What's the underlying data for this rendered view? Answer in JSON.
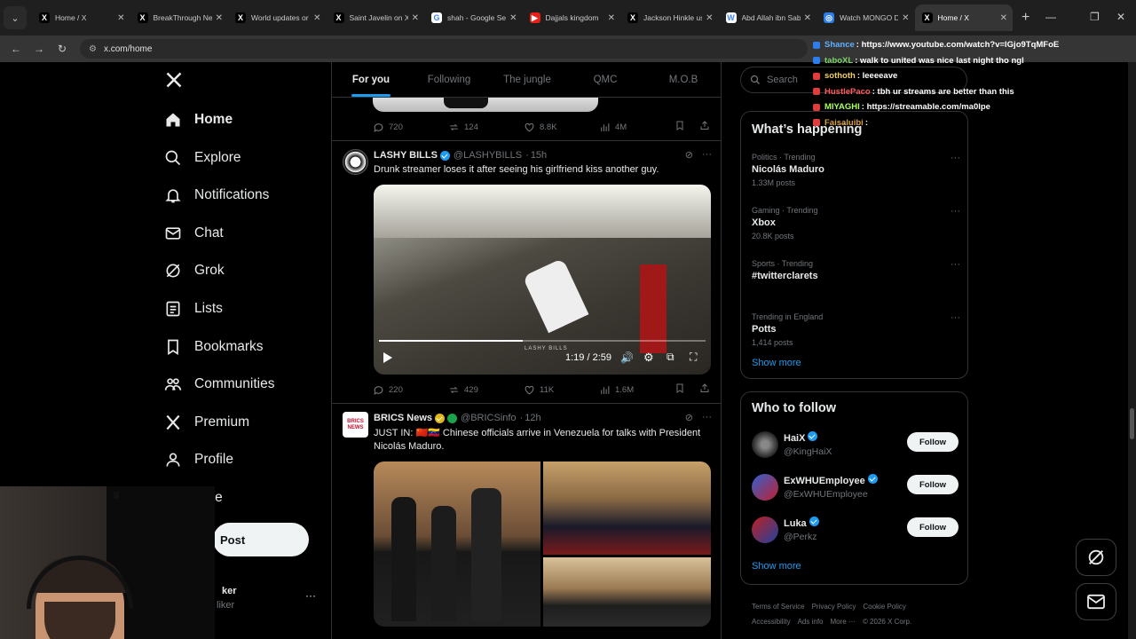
{
  "browser": {
    "tabs": [
      {
        "title": "Home / X",
        "icon": "x-logo-icon",
        "active": false
      },
      {
        "title": "BreakThrough Ne",
        "icon": "x-logo-icon",
        "active": false
      },
      {
        "title": "World updates or",
        "icon": "x-logo-icon",
        "active": false
      },
      {
        "title": "Saint Javelin on X",
        "icon": "x-logo-icon",
        "active": false
      },
      {
        "title": "shah - Google Sea",
        "icon": "google-icon",
        "active": false
      },
      {
        "title": "Dajjals kingdom",
        "icon": "youtube-icon",
        "active": false
      },
      {
        "title": "Jackson Hinkle us",
        "icon": "x-logo-icon",
        "active": false
      },
      {
        "title": "Abd Allah ibn Sab",
        "icon": "wikipedia-icon",
        "active": false
      },
      {
        "title": "Watch MONGO D",
        "icon": "globe-icon",
        "active": false
      },
      {
        "title": "Home / X",
        "icon": "x-logo-icon",
        "active": true
      }
    ],
    "url": "x.com/home"
  },
  "sidebar": {
    "items": [
      {
        "label": "Home",
        "icon": "home-icon"
      },
      {
        "label": "Explore",
        "icon": "search-icon"
      },
      {
        "label": "Notifications",
        "icon": "bell-icon"
      },
      {
        "label": "Chat",
        "icon": "mail-icon"
      },
      {
        "label": "Grok",
        "icon": "grok-icon"
      },
      {
        "label": "Lists",
        "icon": "list-icon"
      },
      {
        "label": "Bookmarks",
        "icon": "bookmark-icon"
      },
      {
        "label": "Communities",
        "icon": "people-icon"
      },
      {
        "label": "Premium",
        "icon": "x-logo-icon"
      },
      {
        "label": "Profile",
        "icon": "person-icon"
      },
      {
        "label": "re",
        "icon": "more-icon"
      }
    ],
    "post_label": "Post",
    "account_name": "ker",
    "account_handle": "liker"
  },
  "feed": {
    "tabs": [
      "For you",
      "Following",
      "The jungle",
      "QMC",
      "M.O.B"
    ],
    "prev_post_stats": {
      "replies": "720",
      "reposts": "124",
      "likes": "8.8K",
      "views": "4M"
    },
    "post1": {
      "name": "LASHY BILLS",
      "handle": "@LASHYBILLS",
      "time": "15h",
      "text": "Drunk streamer loses it after seeing his girlfriend kiss another guy.",
      "video_time": "1:19 / 2:59",
      "video_progress": 0.44,
      "watermark": "LASHY BILLS",
      "stats": {
        "replies": "220",
        "reposts": "429",
        "likes": "11K",
        "views": "1.6M"
      }
    },
    "post2": {
      "name": "BRICS News",
      "handle": "@BRICSinfo",
      "time": "12h",
      "avatar_text": "BRICS NEWS",
      "text": "JUST IN: 🇨🇳🇻🇪 Chinese officials arrive in Venezuela for talks with President Nicolás Maduro."
    }
  },
  "right": {
    "search_placeholder": "Search",
    "happening_title": "What’s happening",
    "trends": [
      {
        "category": "Politics · Trending",
        "name": "Nicolás Maduro",
        "posts": "1.33M posts"
      },
      {
        "category": "Gaming · Trending",
        "name": "Xbox",
        "posts": "20.8K posts"
      },
      {
        "category": "Sports · Trending",
        "name": "#twitterclarets",
        "posts": ""
      },
      {
        "category": "Trending in England",
        "name": "Potts",
        "posts": "1,414 posts"
      }
    ],
    "show_more": "Show more",
    "follow_title": "Who to follow",
    "follows": [
      {
        "name": "HaiX",
        "handle": "@KingHaiX",
        "button": "Follow"
      },
      {
        "name": "ExWHUEmployee",
        "handle": "@ExWHUEmployee",
        "button": "Follow"
      },
      {
        "name": "Luka",
        "handle": "@Perkz",
        "button": "Follow"
      }
    ],
    "show_more_2": "Show more",
    "footer": [
      "Terms of Service",
      "Privacy Policy",
      "Cookie Policy",
      "Accessibility",
      "Ads info",
      "More ···",
      "© 2026 X Corp."
    ]
  },
  "chat_overlay": [
    {
      "user": "Shance",
      "message": ": https://www.youtube.com/watch?v=lGjo9TqMFoE",
      "color": "#5fb0ff"
    },
    {
      "user": "taboXL",
      "message": ": walk to united was nice last night tho ngl",
      "color": "#7bd36a"
    },
    {
      "user": "sothoth",
      "message": ": leeeeave",
      "color": "#f0d060"
    },
    {
      "user": "HustlePaco",
      "message": ": tbh ur streams are better than this",
      "color": "#ff5a5a"
    },
    {
      "user": "MIYAGHI",
      "message": ": https://streamable.com/ma0lpe",
      "color": "#a8ff60"
    },
    {
      "user": "Faisaluibi",
      "message": ":",
      "color": "#d9a23a"
    }
  ]
}
